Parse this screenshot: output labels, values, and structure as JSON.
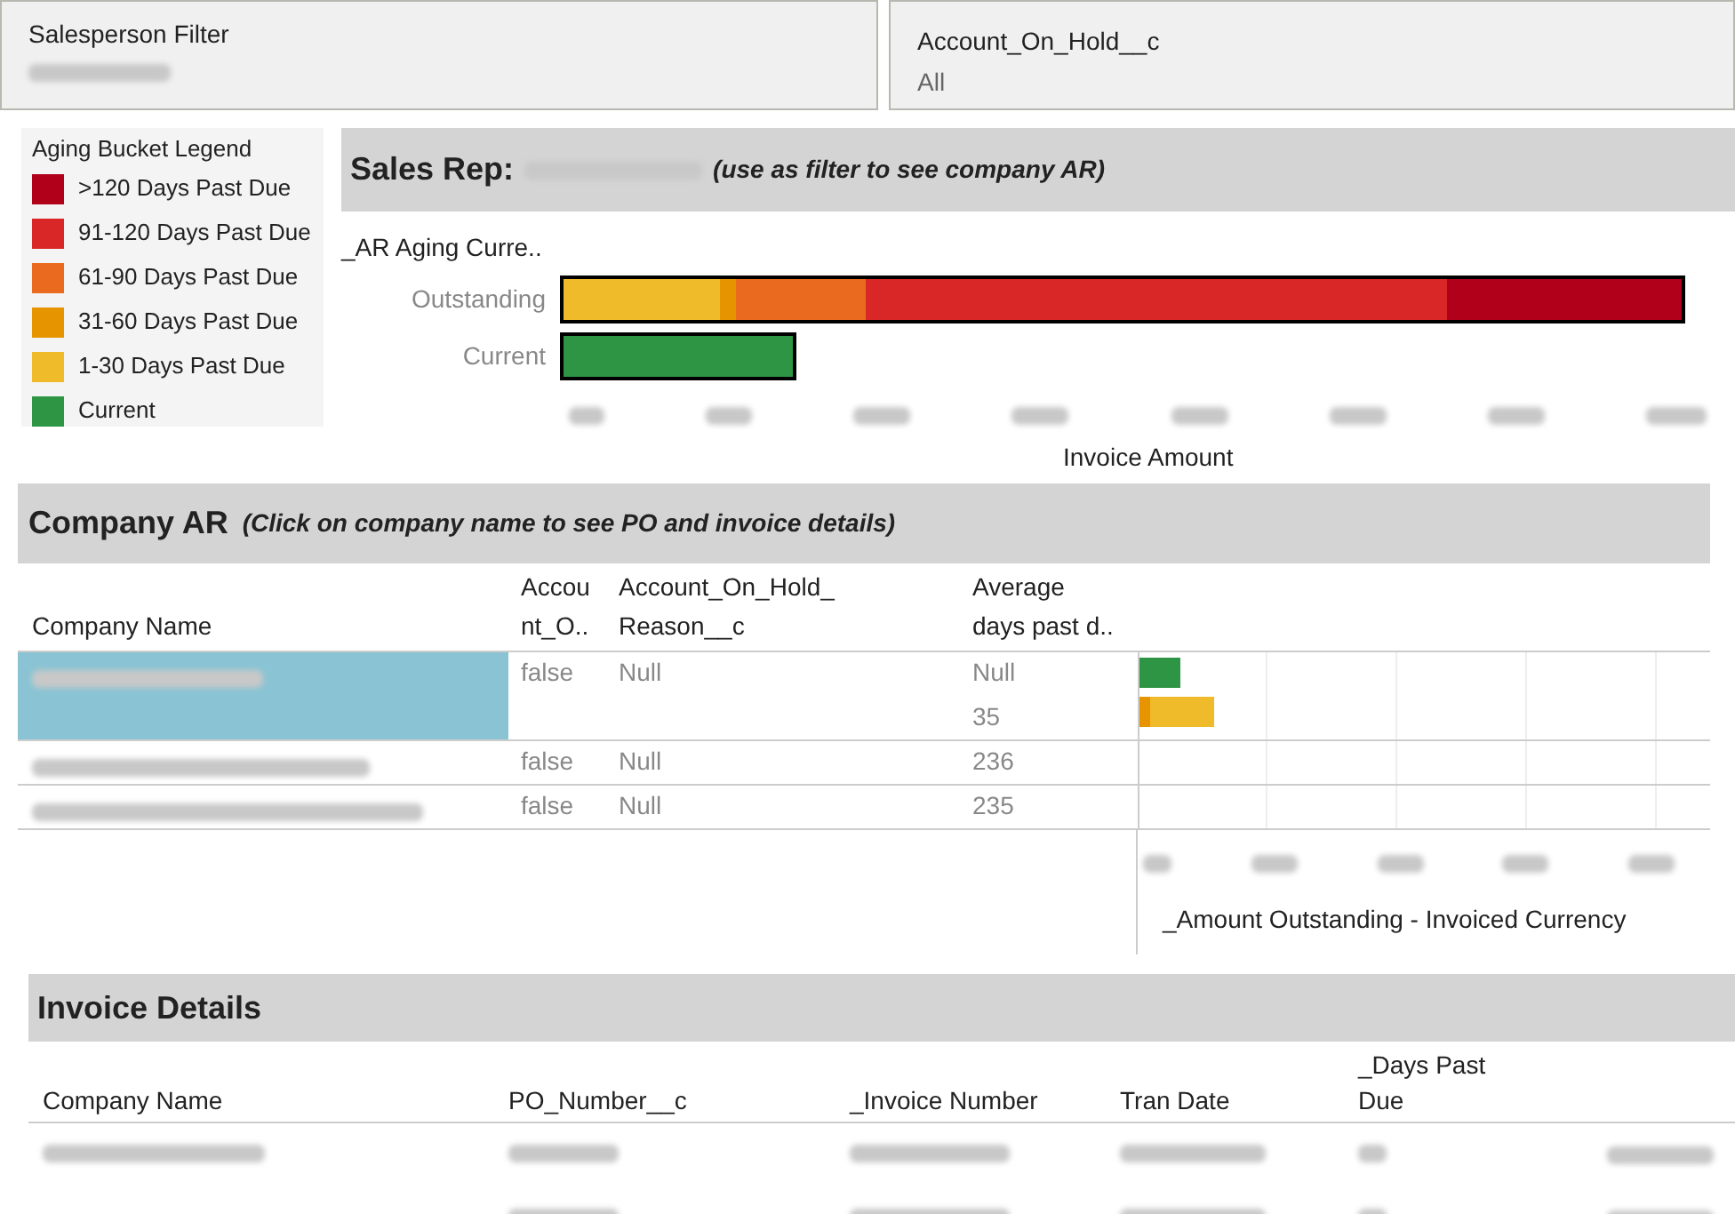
{
  "filters": [
    {
      "label": "Salesperson Filter",
      "value_blurred": true
    },
    {
      "label": "Account_On_Hold__c",
      "value": "All"
    }
  ],
  "legend": {
    "title": "Aging Bucket Legend",
    "items": [
      {
        "label": ">120 Days Past Due",
        "color": "#b0001a"
      },
      {
        "label": "91-120 Days Past Due",
        "color": "#d92626"
      },
      {
        "label": "61-90 Days Past Due",
        "color": "#ea6b1f"
      },
      {
        "label": "31-60 Days Past Due",
        "color": "#e69500"
      },
      {
        "label": "1-30 Days Past Due",
        "color": "#f0bb2a"
      },
      {
        "label": "Current",
        "color": "#2e9544"
      }
    ]
  },
  "sales_rep": {
    "title": "Sales Rep:",
    "note": "(use as filter to see company AR)",
    "axis_header": "_AR Aging Curre..",
    "rows": [
      "Outstanding",
      "Current"
    ],
    "xlabel": "Invoice Amount"
  },
  "company_ar": {
    "title": "Company AR",
    "note": "(Click on company name to see PO and invoice details)",
    "columns": [
      "Company Name",
      "Accou\nnt_O..",
      "Account_On_Hold_\nReason__c",
      "Average\ndays past d.."
    ],
    "rows": [
      {
        "selected": true,
        "account": "false",
        "reason": "Null",
        "avg": [
          "Null",
          "35"
        ]
      },
      {
        "selected": false,
        "account": "false",
        "reason": "Null",
        "avg": [
          "236"
        ]
      },
      {
        "selected": false,
        "account": "false",
        "reason": "Null",
        "avg": [
          "235"
        ]
      }
    ],
    "xlabel": "_Amount Outstanding - Invoiced Currency"
  },
  "invoice_details": {
    "title": "Invoice Details",
    "columns": [
      "Company Name",
      "PO_Number__c",
      "_Invoice Number",
      "Tran Date",
      "_Days Past\nDue"
    ]
  }
}
